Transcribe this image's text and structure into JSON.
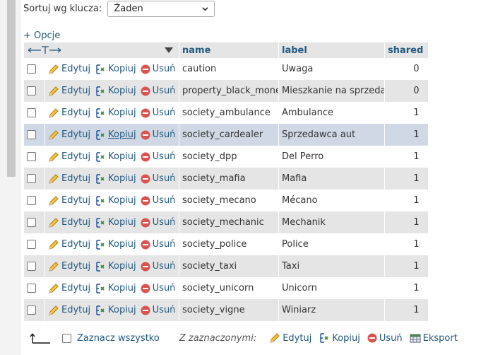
{
  "sort": {
    "label": "Sortuj wg klucza:",
    "selected": "Żaden"
  },
  "options_link": "+ Opcje",
  "columns": {
    "name": "name",
    "label": "label",
    "shared": "shared"
  },
  "actions": {
    "edit": "Edytuj",
    "copy": "Kopiuj",
    "delete": "Usuń"
  },
  "rows": [
    {
      "name": "caution",
      "label": "Uwaga",
      "shared": "0"
    },
    {
      "name": "property_black_money",
      "label": "Mieszkanie na sprzedaż",
      "shared": "0"
    },
    {
      "name": "society_ambulance",
      "label": "Ambulance",
      "shared": "1"
    },
    {
      "name": "society_cardealer",
      "label": "Sprzedawca aut",
      "shared": "1"
    },
    {
      "name": "society_dpp",
      "label": "Del Perro",
      "shared": "1"
    },
    {
      "name": "society_mafia",
      "label": "Mafia",
      "shared": "1"
    },
    {
      "name": "society_mecano",
      "label": "Mécano",
      "shared": "1"
    },
    {
      "name": "society_mechanic",
      "label": "Mechanik",
      "shared": "1"
    },
    {
      "name": "society_police",
      "label": "Police",
      "shared": "1"
    },
    {
      "name": "society_taxi",
      "label": "Taxi",
      "shared": "1"
    },
    {
      "name": "society_unicorn",
      "label": "Unicorn",
      "shared": "1"
    },
    {
      "name": "society_vigne",
      "label": "Winiarz",
      "shared": "1"
    }
  ],
  "footer": {
    "select_all": "Zaznacz wszystko",
    "with_selected": "Z zaznaczonymi:",
    "edit": "Edytuj",
    "copy": "Kopiuj",
    "delete": "Usuń",
    "export": "Eksport"
  },
  "colors": {
    "link": "#235a81",
    "row_even": "#e5e5e5",
    "row_marked": "#cfd8e4",
    "delete_icon": "#d9534f"
  },
  "icons": {
    "edit": "pencil-icon",
    "copy": "copy-insert-icon",
    "delete": "delete-circle-icon",
    "export": "export-icon"
  }
}
